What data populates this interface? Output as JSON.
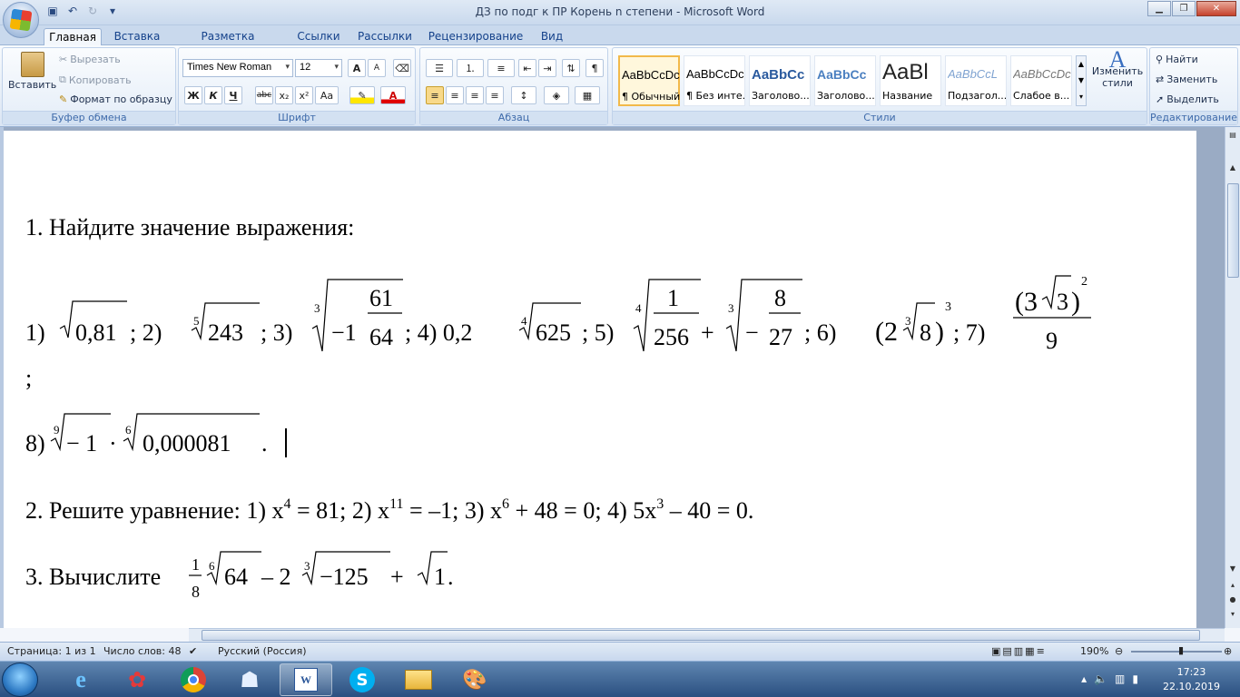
{
  "window": {
    "title": "ДЗ по подг к ПР Корень n степени - Microsoft Word"
  },
  "tabs": [
    "Главная",
    "Вставка",
    "Разметка страницы",
    "Ссылки",
    "Рассылки",
    "Рецензирование",
    "Вид"
  ],
  "clipboard": {
    "paste": "Вставить",
    "cut": "Вырезать",
    "copy": "Копировать",
    "format_painter": "Формат по образцу",
    "label": "Буфер обмена"
  },
  "font": {
    "name": "Times New Roman",
    "size": "12",
    "label": "Шрифт",
    "bold": "Ж",
    "italic": "К",
    "underline": "Ч",
    "strike": "abc",
    "sub": "x₂",
    "sup": "x²",
    "case": "Aa",
    "grow": "A",
    "shrink": "A"
  },
  "paragraph": {
    "label": "Абзац"
  },
  "styles": {
    "label": "Стили",
    "items": [
      {
        "preview": "AaBbCcDc",
        "name": "¶ Обычный"
      },
      {
        "preview": "AaBbCcDc",
        "name": "¶ Без инте..."
      },
      {
        "preview": "AaBbCc",
        "name": "Заголово..."
      },
      {
        "preview": "AaBbCc",
        "name": "Заголово..."
      },
      {
        "preview": "AaBl",
        "name": "Название"
      },
      {
        "preview": "AaBbCcL",
        "name": "Подзагол..."
      },
      {
        "preview": "AaBbCcDc",
        "name": "Слабое в..."
      }
    ],
    "change": "Изменить стили"
  },
  "editing": {
    "label": "Редактирование",
    "find": "Найти",
    "replace": "Заменить",
    "select": "Выделить"
  },
  "document": {
    "line1": "1. Найдите значение выражения:",
    "l2": {
      "p1": "1) ",
      "r1": "0,81",
      "t1": ";    2)",
      "i2": "5",
      "r2": "243",
      "t2": ";  3) ",
      "i3": "3",
      "m3": "−1",
      "n3": "61",
      "d3": "64",
      "t3": " ;     4)  0,2",
      "i4": "4",
      "r4": "625",
      "t4": " ; 5) ",
      "i5": "4",
      "n5": "1",
      "d5": "256",
      "t5": " + ",
      "i5b": "3",
      "m5b": "−",
      "n5b": "8",
      "d5b": "27",
      "t5b": " ;    6) ",
      "p6": "(2",
      "i6": "3",
      "r6": "8",
      "e6": "3",
      "t6": ";   7) ",
      "n7a": "(3",
      "r7": "3",
      "e7": "2",
      "d7": "9"
    },
    "line3": ";",
    "l4": {
      "a": "8)",
      "i1": "9",
      "r1": "− 1",
      "dot": " · ",
      "i2": "6",
      "r2": "0,000081",
      "end": " ."
    },
    "l5": {
      "a": "2. Решите уравнение: 1) x",
      "e1": "4",
      "b": " = 81; 2) x",
      "e2": "11",
      "c": " = –1; 3) x",
      "e3": "6",
      "d": " + 48 = 0; 4) 5x",
      "e4": "3",
      "e": " – 40 = 0."
    },
    "l6": {
      "a": "3. Вычислите ",
      "n": "1",
      "dn": "8",
      "i1": "6",
      "r1": "64",
      "b": " – 2",
      "i2": "3",
      "r2": "−125",
      "c": " + ",
      "r3": "1",
      "d": "."
    }
  },
  "status": {
    "page": "Страница: 1 из 1",
    "words": "Число слов: 48",
    "lang": "Русский (Россия)",
    "zoom": "190%"
  },
  "clock": {
    "time": "17:23",
    "date": "22.10.2019"
  }
}
